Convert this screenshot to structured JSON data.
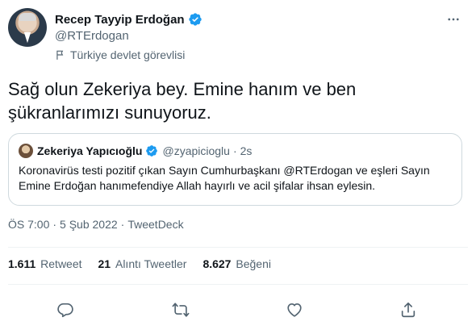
{
  "author": {
    "display_name": "Recep Tayyip Erdoğan",
    "handle": "@RTErdogan",
    "affiliation": "Türkiye devlet görevlisi"
  },
  "tweet": {
    "text": "Sağ olun Zekeriya bey. Emine hanım ve ben şükranlarımızı sunuyoruz."
  },
  "quoted": {
    "display_name": "Zekeriya Yapıcıoğlu",
    "handle": "@zyapicioglu",
    "separator": "·",
    "time": "2s",
    "text": "Koronavirüs testi pozitif çıkan Sayın Cumhurbaşkanı @RTErdogan ve eşleri Sayın Emine Erdoğan hanımefendiye Allah hayırlı ve acil şifalar ihsan eylesin."
  },
  "meta": {
    "time": "ÖS 7:00",
    "separator": "·",
    "date": "5 Şub 2022",
    "source": "TweetDeck"
  },
  "stats": {
    "retweets_count": "1.611",
    "retweets_label": "Retweet",
    "quotes_count": "21",
    "quotes_label": "Alıntı Tweetler",
    "likes_count": "8.627",
    "likes_label": "Beğeni"
  },
  "icons": {
    "verified": "verified-badge-icon",
    "flag": "flag-icon",
    "more": "more-icon",
    "reply": "reply-icon",
    "retweet": "retweet-icon",
    "like": "heart-icon",
    "share": "share-icon"
  },
  "colors": {
    "verified_blue": "#1d9bf0",
    "text_primary": "#0f1419",
    "text_secondary": "#536471",
    "border": "#cfd9de"
  }
}
